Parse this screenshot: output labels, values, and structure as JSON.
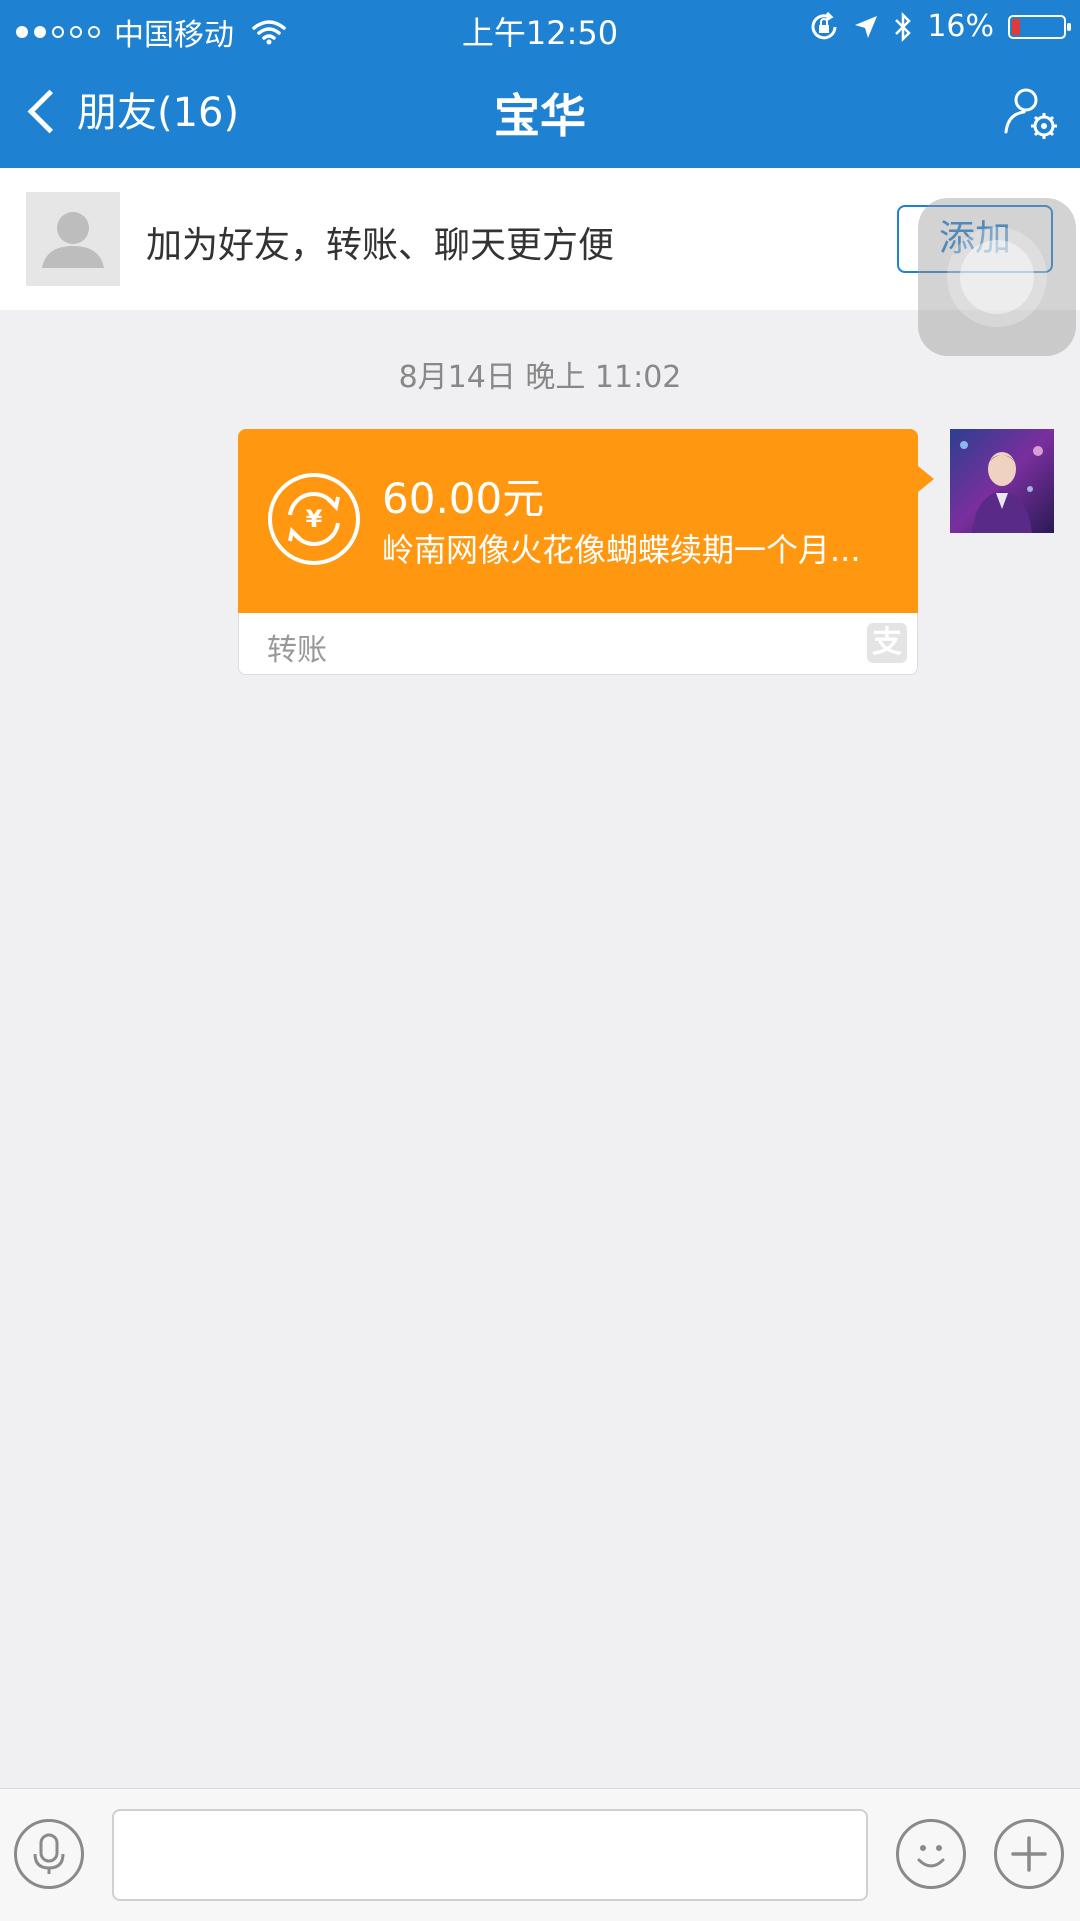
{
  "status_bar": {
    "carrier": "中国移动",
    "time": "上午12:50",
    "battery": "16%",
    "battery_level": 0.16,
    "signal_bars": 2
  },
  "nav": {
    "back_label": "朋友(16)",
    "title": "宝华"
  },
  "add_friend_banner": {
    "message": "加为好友，转账、聊天更方便",
    "add_button": "添加"
  },
  "chat": {
    "timestamp": "8月14日 晚上 11:02",
    "transfer": {
      "amount": "60.00元",
      "memo": "岭南网像火花像蝴蝶续期一个月...",
      "type_label": "转账",
      "badge": "支"
    }
  },
  "colors": {
    "brand_blue": "#1f81d1",
    "transfer_orange": "#ff9810",
    "background": "#f0f0f2"
  },
  "icons": {
    "wifi": "wifi-icon",
    "rotation_lock": "rotation-lock-icon",
    "location": "location-arrow-icon",
    "bluetooth": "bluetooth-icon",
    "profile_settings": "profile-settings-icon",
    "transfer": "currency-exchange-icon",
    "voice": "microphone-icon",
    "emoji": "smiley-icon",
    "more": "plus-icon"
  }
}
